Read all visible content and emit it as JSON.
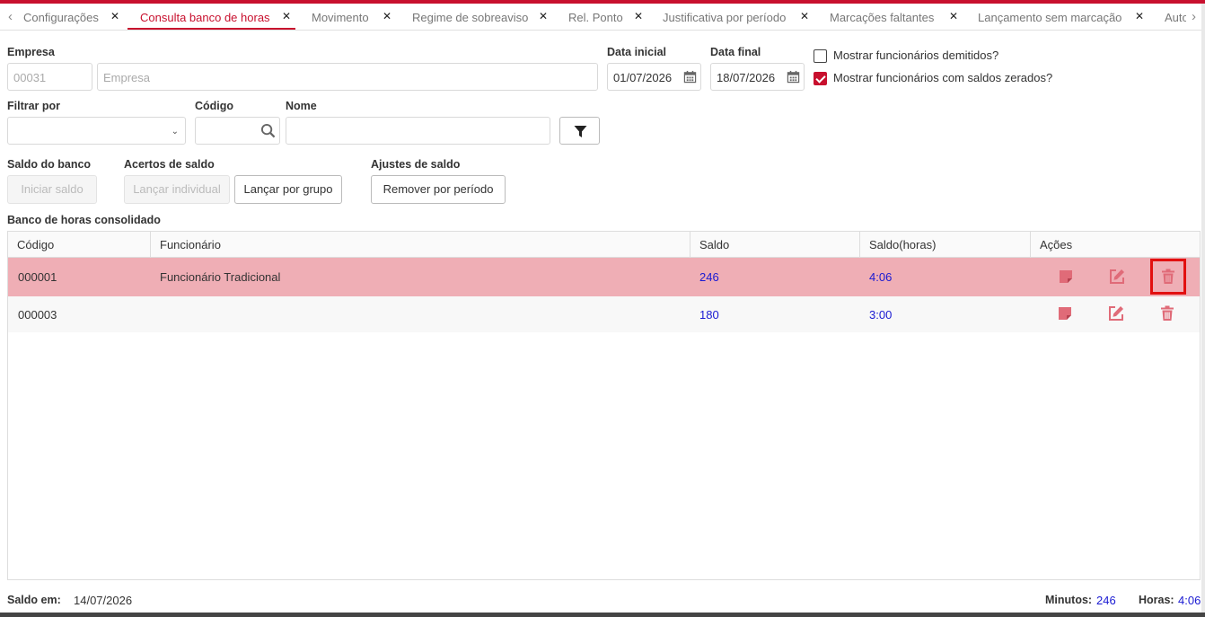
{
  "tabs": {
    "prev_icon": "chevron-left-icon",
    "items": [
      {
        "label": "Configurações"
      },
      {
        "label": "Consulta banco de horas"
      },
      {
        "label": "Movimento"
      },
      {
        "label": "Regime de sobreaviso"
      },
      {
        "label": "Rel. Ponto"
      },
      {
        "label": "Justificativa por período"
      },
      {
        "label": "Marcações faltantes"
      },
      {
        "label": "Lançamento sem marcação"
      },
      {
        "label": "Auto"
      }
    ],
    "active_index": 1,
    "close_glyph": "✕",
    "next_icon": "chevron-right-icon"
  },
  "form": {
    "empresa_label": "Empresa",
    "empresa_code_value": "00031",
    "empresa_name_placeholder": "Empresa",
    "data_inicial_label": "Data inicial",
    "data_inicial_value": "01/07/2026",
    "data_final_label": "Data final",
    "data_final_value": "18/07/2026",
    "mostrar_demitidos_label": "Mostrar funcionários demitidos?",
    "mostrar_demitidos_checked": false,
    "mostrar_zerados_label": "Mostrar funcionários com saldos zerados?",
    "mostrar_zerados_checked": true,
    "filtrar_por_label": "Filtrar por",
    "filtrar_por_value": "",
    "codigo_label": "Código",
    "codigo_value": "",
    "nome_label": "Nome",
    "nome_value": ""
  },
  "actions": {
    "saldo_banco_label": "Saldo do banco",
    "iniciar_saldo": "Iniciar saldo",
    "acertos_label": "Acertos de saldo",
    "lancar_individual": "Lançar individual",
    "lancar_grupo": "Lançar por grupo",
    "ajustes_label": "Ajustes de saldo",
    "remover_periodo": "Remover por período"
  },
  "grid": {
    "title": "Banco de horas consolidado",
    "columns": [
      "Código",
      "Funcionário",
      "Saldo",
      "Saldo(horas)",
      "Ações"
    ],
    "rows": [
      {
        "codigo": "000001",
        "funcionario": "Funcionário Tradicional",
        "saldo": "246",
        "saldo_horas": "4:06",
        "selected": true
      },
      {
        "codigo": "000003",
        "funcionario": "",
        "saldo": "180",
        "saldo_horas": "3:00",
        "selected": false
      }
    ],
    "action_icons": [
      "note-icon",
      "edit-icon",
      "trash-icon"
    ]
  },
  "footer": {
    "saldo_em_label": "Saldo em:",
    "saldo_em_value": "14/07/2026",
    "minutos_label": "Minutos:",
    "minutos_value": "246",
    "horas_label": "Horas:",
    "horas_value": "4:06"
  },
  "colors": {
    "accent": "#c8102e",
    "selected_row": "#efaeb5",
    "number_blue": "#1a1ad2",
    "icon_pink": "#e06b78"
  }
}
